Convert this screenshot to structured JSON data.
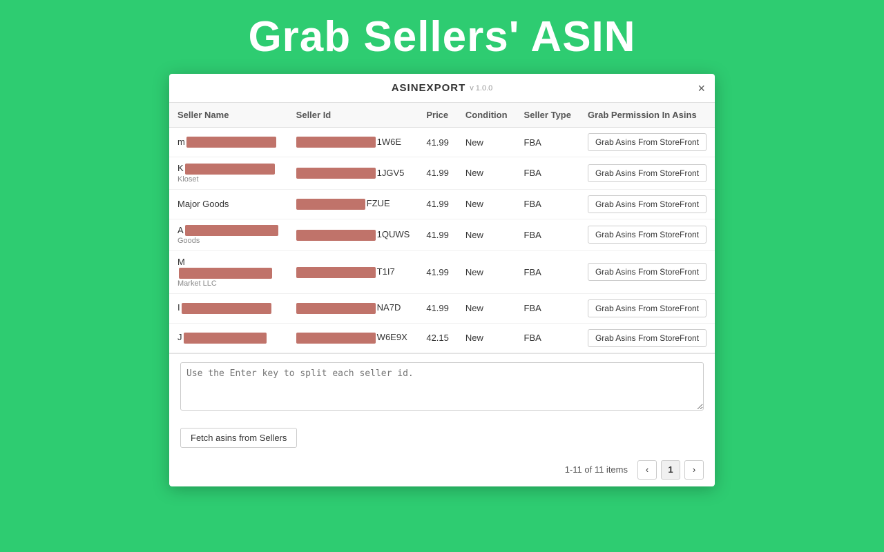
{
  "page": {
    "title": "Grab Sellers' ASIN",
    "background_color": "#2ecc71"
  },
  "modal": {
    "title": "ASINEXPORT",
    "version": "v 1.0.0",
    "close_label": "×",
    "columns": {
      "seller_name": "Seller Name",
      "seller_id": "Seller Id",
      "price": "Price",
      "condition": "Condition",
      "seller_type": "Seller Type",
      "grab_permission": "Grab Permission In Asins"
    },
    "rows": [
      {
        "seller_name": "m",
        "seller_id_suffix": "1W6E",
        "seller_sub": "",
        "price": "41.99",
        "condition": "New",
        "seller_type": "FBA",
        "btn_label": "Grab Asins From StoreFront"
      },
      {
        "seller_name": "K",
        "seller_id_suffix": "1JGV5",
        "seller_sub": "Kloset",
        "price": "41.99",
        "condition": "New",
        "seller_type": "FBA",
        "btn_label": "Grab Asins From StoreFront"
      },
      {
        "seller_name": "Major Goods",
        "seller_id_suffix": "FZUE",
        "seller_sub": "",
        "price": "41.99",
        "condition": "New",
        "seller_type": "FBA",
        "btn_label": "Grab Asins From StoreFront"
      },
      {
        "seller_name": "A",
        "seller_id_suffix": "1QUWS",
        "seller_sub": "Goods",
        "price": "41.99",
        "condition": "New",
        "seller_type": "FBA",
        "btn_label": "Grab Asins From StoreFront"
      },
      {
        "seller_name": "M",
        "seller_id_suffix": "T1I7",
        "seller_sub": "Market LLC",
        "price": "41.99",
        "condition": "New",
        "seller_type": "FBA",
        "btn_label": "Grab Asins From StoreFront"
      },
      {
        "seller_name": "I",
        "seller_id_suffix": "NA7D",
        "seller_sub": "",
        "price": "41.99",
        "condition": "New",
        "seller_type": "FBA",
        "btn_label": "Grab Asins From StoreFront"
      },
      {
        "seller_name": "J",
        "seller_id_suffix": "W6E9X",
        "seller_sub": "",
        "price": "42.15",
        "condition": "New",
        "seller_type": "FBA",
        "btn_label": "Grab Asins From StoreFront"
      }
    ],
    "textarea_placeholder": "Use the Enter key to split each seller id.",
    "fetch_btn_label": "Fetch asins from Sellers",
    "pagination": {
      "info": "1-11 of 11 items",
      "current_page": "1",
      "prev_label": "‹",
      "next_label": "›"
    }
  }
}
